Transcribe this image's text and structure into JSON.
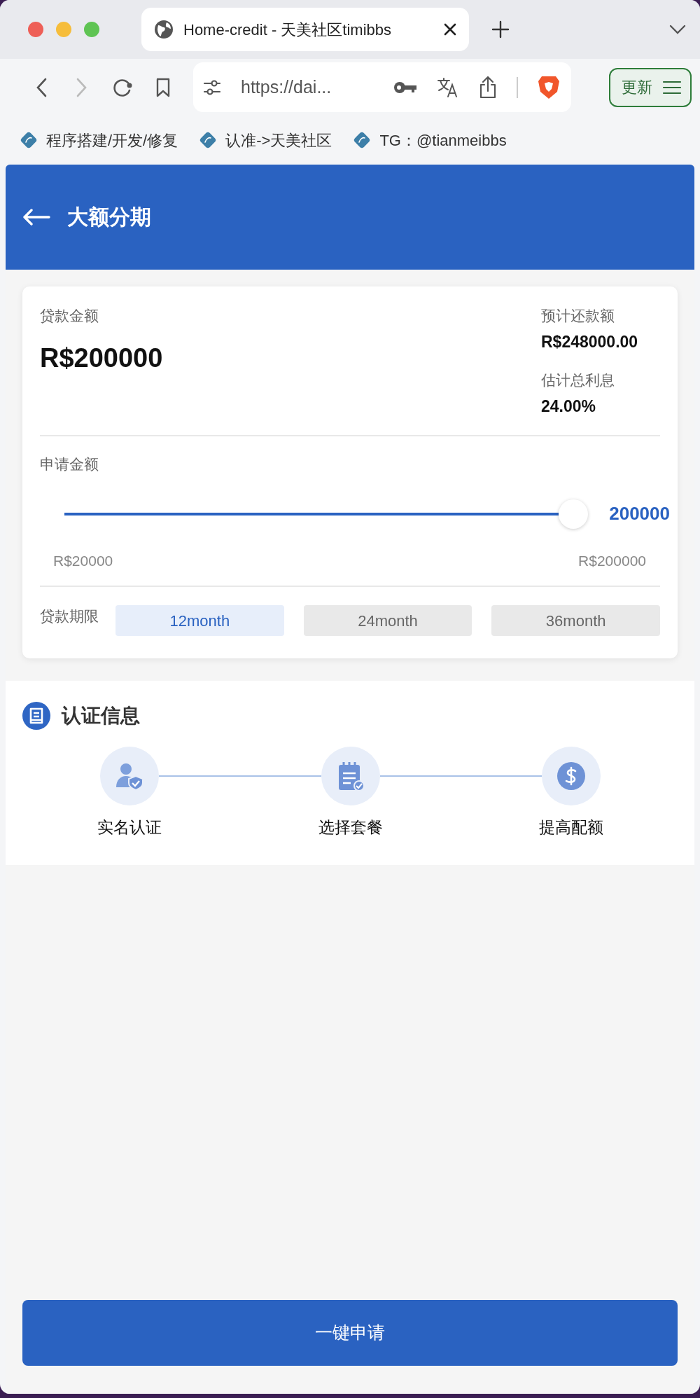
{
  "browser": {
    "tab_title": "Home-credit - 天美社区timibbs",
    "url": "https://dai...",
    "update_label": "更新"
  },
  "bookmarks": [
    {
      "label": "程序搭建/开发/修复"
    },
    {
      "label": "认准->天美社区"
    },
    {
      "label": "TG：@tianmeibbs"
    }
  ],
  "header": {
    "title": "大额分期"
  },
  "loan": {
    "amount_label": "贷款金额",
    "amount": "R$200000",
    "repay_label": "预计还款额",
    "repay": "R$248000.00",
    "interest_label": "估计总利息",
    "interest": "24.00%",
    "apply_label": "申请金额",
    "slider": {
      "level": 1,
      "value": "200000",
      "min": "R$20000",
      "max": "R$200000"
    },
    "term_label": "贷款期限",
    "terms": [
      {
        "label": "12month",
        "selected": true
      },
      {
        "label": "24month",
        "selected": false
      },
      {
        "label": "36month",
        "selected": false
      }
    ]
  },
  "auth": {
    "title": "认证信息",
    "steps": [
      {
        "kind": "identity",
        "label": "实名认证"
      },
      {
        "kind": "plan",
        "label": "选择套餐"
      },
      {
        "kind": "credit",
        "label": "提高配额"
      }
    ]
  },
  "submit": "一键申请"
}
